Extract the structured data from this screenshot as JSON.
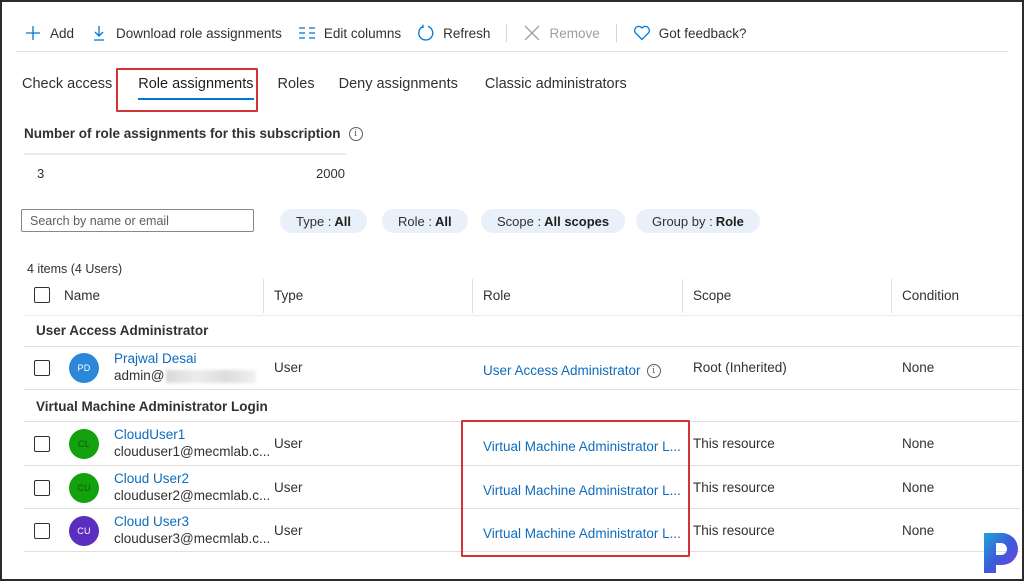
{
  "toolbar": {
    "add": {
      "label": "Add",
      "icon": "plus-icon"
    },
    "download": {
      "label": "Download role assignments",
      "icon": "download-icon"
    },
    "edit_columns": {
      "label": "Edit columns",
      "icon": "columns-icon"
    },
    "refresh": {
      "label": "Refresh",
      "icon": "refresh-icon"
    },
    "remove": {
      "label": "Remove",
      "icon": "close-icon",
      "disabled": true
    },
    "feedback": {
      "label": "Got feedback?",
      "icon": "heart-icon"
    }
  },
  "tabs": [
    {
      "label": "Check access",
      "active": false
    },
    {
      "label": "Role assignments",
      "active": true
    },
    {
      "label": "Roles",
      "active": false
    },
    {
      "label": "Deny assignments",
      "active": false
    },
    {
      "label": "Classic administrators",
      "active": false
    }
  ],
  "subscription": {
    "label": "Number of role assignments for this subscription",
    "current": "3",
    "limit": "2000"
  },
  "search": {
    "placeholder": "Search by name or email",
    "value": ""
  },
  "filters": [
    {
      "key": "Type :",
      "value": "All"
    },
    {
      "key": "Role :",
      "value": "All"
    },
    {
      "key": "Scope :",
      "value": "All scopes"
    },
    {
      "key": "Group by :",
      "value": "Role"
    }
  ],
  "table": {
    "items_count": "4 items (4 Users)",
    "columns": [
      "Name",
      "Type",
      "Role",
      "Scope",
      "Condition"
    ],
    "groups": [
      {
        "title": "User Access Administrator",
        "rows": [
          {
            "initials": "PD",
            "avatar_color": "#2b88d8",
            "name": "Prajwal Desai",
            "email": "admin@",
            "email_redacted": true,
            "type": "User",
            "role": "User Access Administrator",
            "role_info": true,
            "scope": "Root (Inherited)",
            "condition": "None"
          }
        ]
      },
      {
        "title": "Virtual Machine Administrator Login",
        "rows": [
          {
            "initials": "CL",
            "avatar_color": "#13a10e",
            "name": "CloudUser1",
            "email": "clouduser1@mecmlab.c...",
            "type": "User",
            "role": "Virtual Machine Administrator L...",
            "scope": "This resource",
            "condition": "None"
          },
          {
            "initials": "CU",
            "avatar_color": "#13a10e",
            "name": "Cloud User2",
            "email": "clouduser2@mecmlab.c...",
            "type": "User",
            "role": "Virtual Machine Administrator L...",
            "scope": "This resource",
            "condition": "None"
          },
          {
            "initials": "CU",
            "avatar_color": "#5c2ebf",
            "name": "Cloud User3",
            "email": "clouduser3@mecmlab.c...",
            "type": "User",
            "role": "Virtual Machine Administrator L...",
            "scope": "This resource",
            "condition": "None"
          }
        ]
      }
    ]
  },
  "colors": {
    "accent": "#0078d4",
    "link": "#0f6cbd",
    "highlight": "#d13438",
    "pill_bg": "#e8f1f9"
  }
}
